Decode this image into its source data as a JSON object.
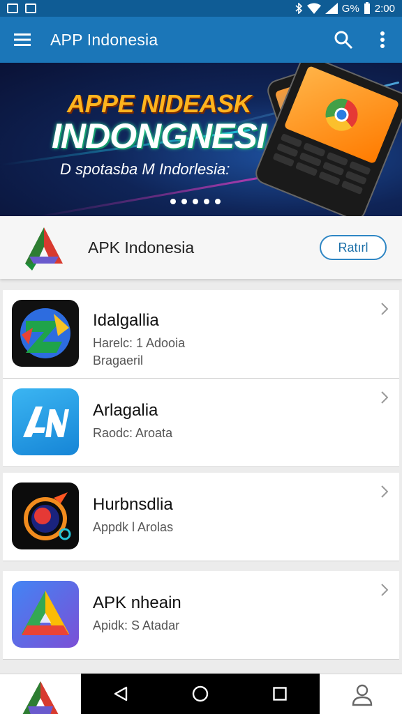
{
  "status_bar": {
    "signal_text": "G%",
    "time": "2:00"
  },
  "app_bar": {
    "title": "APP Indonesia",
    "icons": [
      "menu-icon",
      "search-icon",
      "more-vert-icon"
    ]
  },
  "banner": {
    "line1": "APPE NIDEASK",
    "line2": "INDONGNESIA",
    "line3": "D spotasba M Indorlesia:",
    "slide_count": 5
  },
  "featured": {
    "name": "APK Indonesia",
    "button_label": "Ratırl"
  },
  "apps": [
    {
      "title": "Idalgallia",
      "line1": "Harelc: 1 Adooia",
      "line2": "Bragaeril"
    },
    {
      "title": "Arlagalia",
      "line1": "Raodc: Aroata",
      "line2": ""
    },
    {
      "title": "Hurbnsdlia",
      "line1": "Appdk l Arolas",
      "line2": ""
    },
    {
      "title": "APK nheain",
      "line1": "Apidk: S Atadar",
      "line2": ""
    }
  ],
  "colors": {
    "app_bar": "#1b76b8",
    "status_bar": "#0f5c95",
    "accent": "#2e86c4"
  }
}
